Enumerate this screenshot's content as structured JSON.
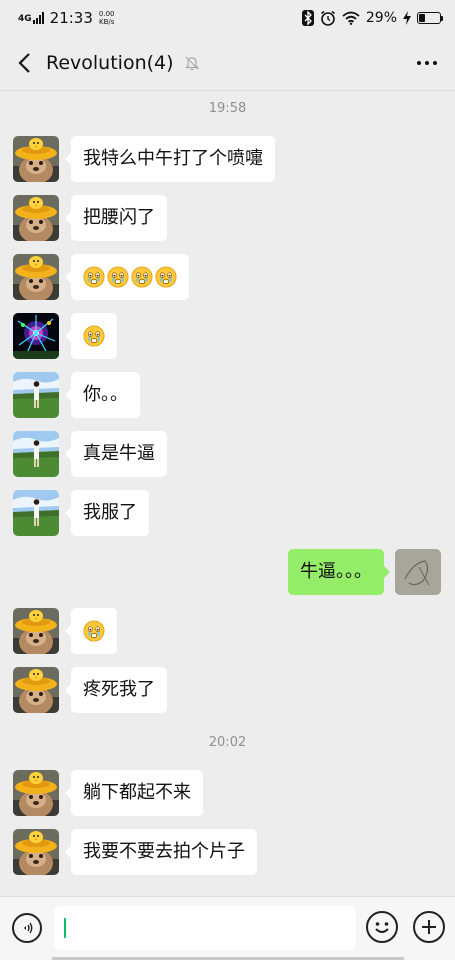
{
  "status_bar": {
    "network": "4G",
    "time": "21:33",
    "speed_value": "0.00",
    "speed_unit": "KB/s",
    "battery_level": 0.29,
    "battery_text": "29%",
    "icons": [
      "bluetooth-icon",
      "alarm-icon",
      "wifi-icon",
      "charging-icon",
      "battery-icon"
    ]
  },
  "header": {
    "back_icon": "chevron-left-icon",
    "title": "Revolution(4)",
    "mute_icon": "bell-off-icon",
    "more_icon": "ellipsis-icon"
  },
  "messages": {
    "time_1": "19:58",
    "m1": "我特么中午打了个喷嚏",
    "m2": "把腰闪了",
    "m3_emoji": "crying-face-emoji x4",
    "m4_emoji": "crying-face-emoji",
    "m5": "你。。",
    "m6": "真是牛逼",
    "m7": "我服了",
    "m8": "牛逼。。。",
    "m9_emoji": "crying-face-emoji",
    "m10": "疼死我了",
    "time_2": "20:02",
    "m11": "躺下都起不来",
    "m12": "我要不要去拍个片子"
  },
  "avatars": {
    "teddy_bear": "teddy-bear-avatar",
    "fireworks": "fireworks-avatar",
    "field_photo": "field-photo-avatar",
    "sketch": "sketch-avatar"
  },
  "colors": {
    "background": "#ededed",
    "incoming_bubble": "#ffffff",
    "outgoing_bubble": "#95ec69",
    "timestamp": "#8f8f8f",
    "cursor": "#07c160"
  },
  "input_bar": {
    "voice_icon": "voice-icon",
    "emoji_icon": "smiley-icon",
    "plus_icon": "plus-icon",
    "value": ""
  }
}
